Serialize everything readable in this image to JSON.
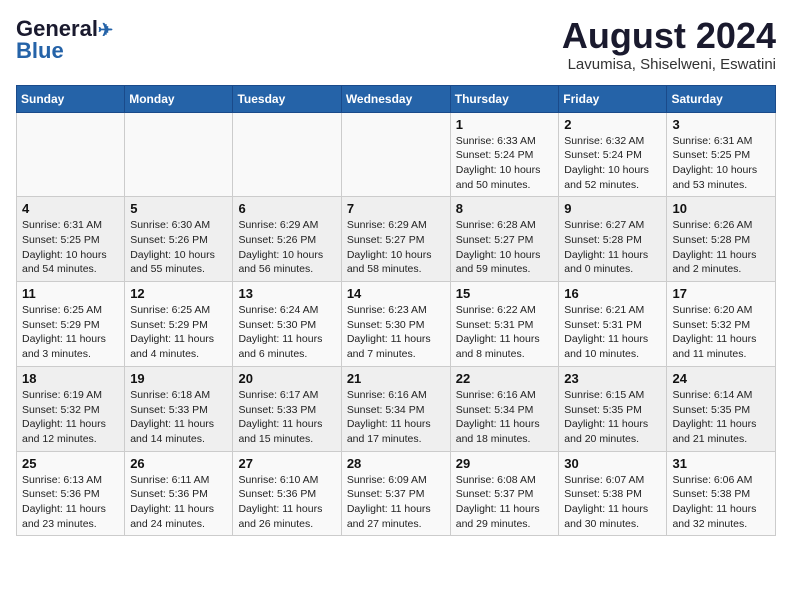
{
  "header": {
    "logo_line1": "General",
    "logo_line2": "Blue",
    "month_year": "August 2024",
    "location": "Lavumisa, Shiselweni, Eswatini"
  },
  "weekdays": [
    "Sunday",
    "Monday",
    "Tuesday",
    "Wednesday",
    "Thursday",
    "Friday",
    "Saturday"
  ],
  "weeks": [
    [
      {
        "day": "",
        "info": ""
      },
      {
        "day": "",
        "info": ""
      },
      {
        "day": "",
        "info": ""
      },
      {
        "day": "",
        "info": ""
      },
      {
        "day": "1",
        "info": "Sunrise: 6:33 AM\nSunset: 5:24 PM\nDaylight: 10 hours\nand 50 minutes."
      },
      {
        "day": "2",
        "info": "Sunrise: 6:32 AM\nSunset: 5:24 PM\nDaylight: 10 hours\nand 52 minutes."
      },
      {
        "day": "3",
        "info": "Sunrise: 6:31 AM\nSunset: 5:25 PM\nDaylight: 10 hours\nand 53 minutes."
      }
    ],
    [
      {
        "day": "4",
        "info": "Sunrise: 6:31 AM\nSunset: 5:25 PM\nDaylight: 10 hours\nand 54 minutes."
      },
      {
        "day": "5",
        "info": "Sunrise: 6:30 AM\nSunset: 5:26 PM\nDaylight: 10 hours\nand 55 minutes."
      },
      {
        "day": "6",
        "info": "Sunrise: 6:29 AM\nSunset: 5:26 PM\nDaylight: 10 hours\nand 56 minutes."
      },
      {
        "day": "7",
        "info": "Sunrise: 6:29 AM\nSunset: 5:27 PM\nDaylight: 10 hours\nand 58 minutes."
      },
      {
        "day": "8",
        "info": "Sunrise: 6:28 AM\nSunset: 5:27 PM\nDaylight: 10 hours\nand 59 minutes."
      },
      {
        "day": "9",
        "info": "Sunrise: 6:27 AM\nSunset: 5:28 PM\nDaylight: 11 hours\nand 0 minutes."
      },
      {
        "day": "10",
        "info": "Sunrise: 6:26 AM\nSunset: 5:28 PM\nDaylight: 11 hours\nand 2 minutes."
      }
    ],
    [
      {
        "day": "11",
        "info": "Sunrise: 6:25 AM\nSunset: 5:29 PM\nDaylight: 11 hours\nand 3 minutes."
      },
      {
        "day": "12",
        "info": "Sunrise: 6:25 AM\nSunset: 5:29 PM\nDaylight: 11 hours\nand 4 minutes."
      },
      {
        "day": "13",
        "info": "Sunrise: 6:24 AM\nSunset: 5:30 PM\nDaylight: 11 hours\nand 6 minutes."
      },
      {
        "day": "14",
        "info": "Sunrise: 6:23 AM\nSunset: 5:30 PM\nDaylight: 11 hours\nand 7 minutes."
      },
      {
        "day": "15",
        "info": "Sunrise: 6:22 AM\nSunset: 5:31 PM\nDaylight: 11 hours\nand 8 minutes."
      },
      {
        "day": "16",
        "info": "Sunrise: 6:21 AM\nSunset: 5:31 PM\nDaylight: 11 hours\nand 10 minutes."
      },
      {
        "day": "17",
        "info": "Sunrise: 6:20 AM\nSunset: 5:32 PM\nDaylight: 11 hours\nand 11 minutes."
      }
    ],
    [
      {
        "day": "18",
        "info": "Sunrise: 6:19 AM\nSunset: 5:32 PM\nDaylight: 11 hours\nand 12 minutes."
      },
      {
        "day": "19",
        "info": "Sunrise: 6:18 AM\nSunset: 5:33 PM\nDaylight: 11 hours\nand 14 minutes."
      },
      {
        "day": "20",
        "info": "Sunrise: 6:17 AM\nSunset: 5:33 PM\nDaylight: 11 hours\nand 15 minutes."
      },
      {
        "day": "21",
        "info": "Sunrise: 6:16 AM\nSunset: 5:34 PM\nDaylight: 11 hours\nand 17 minutes."
      },
      {
        "day": "22",
        "info": "Sunrise: 6:16 AM\nSunset: 5:34 PM\nDaylight: 11 hours\nand 18 minutes."
      },
      {
        "day": "23",
        "info": "Sunrise: 6:15 AM\nSunset: 5:35 PM\nDaylight: 11 hours\nand 20 minutes."
      },
      {
        "day": "24",
        "info": "Sunrise: 6:14 AM\nSunset: 5:35 PM\nDaylight: 11 hours\nand 21 minutes."
      }
    ],
    [
      {
        "day": "25",
        "info": "Sunrise: 6:13 AM\nSunset: 5:36 PM\nDaylight: 11 hours\nand 23 minutes."
      },
      {
        "day": "26",
        "info": "Sunrise: 6:11 AM\nSunset: 5:36 PM\nDaylight: 11 hours\nand 24 minutes."
      },
      {
        "day": "27",
        "info": "Sunrise: 6:10 AM\nSunset: 5:36 PM\nDaylight: 11 hours\nand 26 minutes."
      },
      {
        "day": "28",
        "info": "Sunrise: 6:09 AM\nSunset: 5:37 PM\nDaylight: 11 hours\nand 27 minutes."
      },
      {
        "day": "29",
        "info": "Sunrise: 6:08 AM\nSunset: 5:37 PM\nDaylight: 11 hours\nand 29 minutes."
      },
      {
        "day": "30",
        "info": "Sunrise: 6:07 AM\nSunset: 5:38 PM\nDaylight: 11 hours\nand 30 minutes."
      },
      {
        "day": "31",
        "info": "Sunrise: 6:06 AM\nSunset: 5:38 PM\nDaylight: 11 hours\nand 32 minutes."
      }
    ]
  ]
}
